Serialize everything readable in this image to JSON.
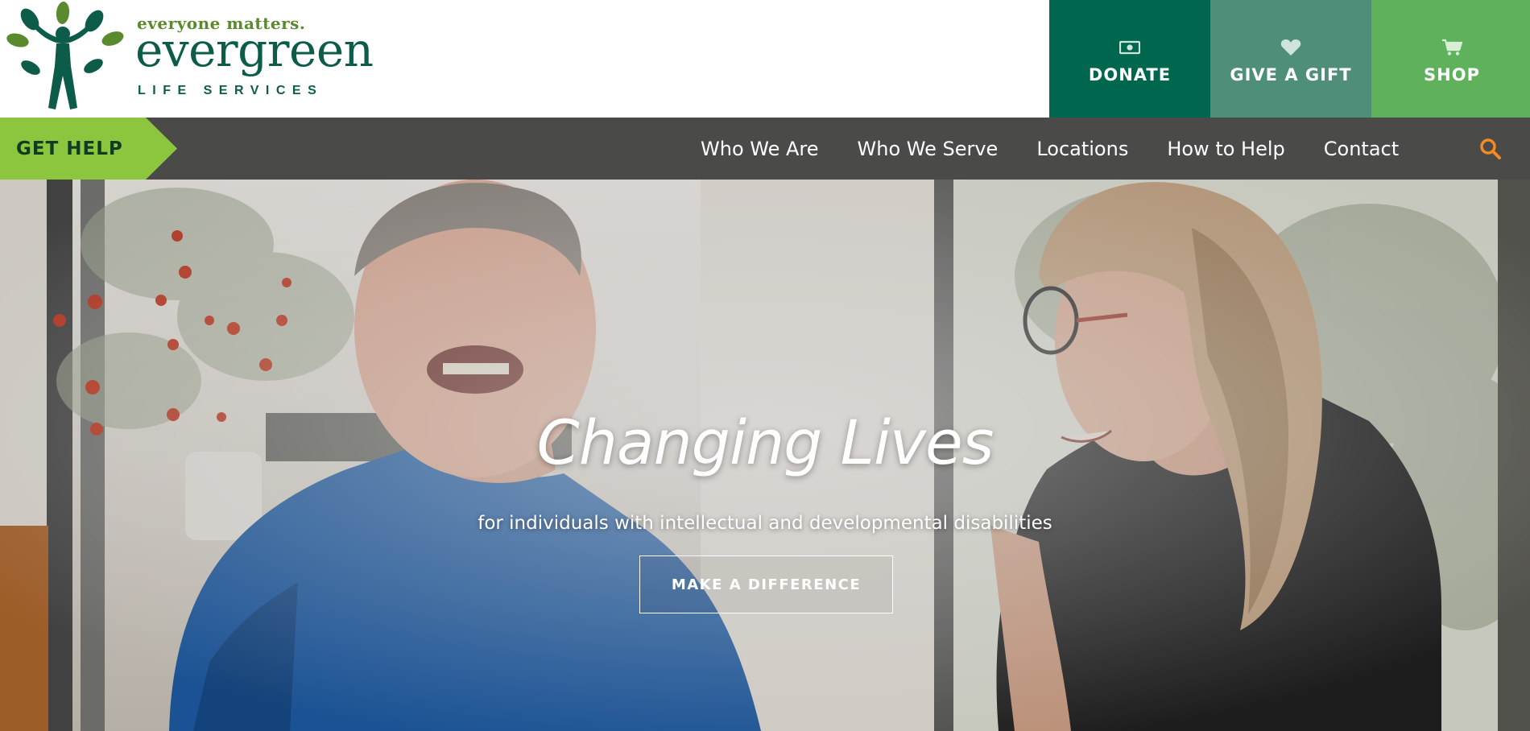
{
  "header": {
    "logo": {
      "tagline": "everyone matters.",
      "name": "evergreen",
      "subtitle": "LIFE SERVICES"
    },
    "top_actions": [
      {
        "label": "DONATE",
        "icon": "money-icon",
        "color": "#00674f"
      },
      {
        "label": "GIVE A GIFT",
        "icon": "heart-icon",
        "color": "#4f8f7a"
      },
      {
        "label": "SHOP",
        "icon": "cart-icon",
        "color": "#5fb15c"
      }
    ]
  },
  "nav": {
    "get_help_label": "GET HELP",
    "get_help_color": "#8cc63f",
    "background": "#4a4a49",
    "links": [
      "Who We Are",
      "Who We Serve",
      "Locations",
      "How to Help",
      "Contact"
    ],
    "search_icon": "search-icon",
    "search_color": "#f58a23"
  },
  "hero": {
    "title": "Changing Lives",
    "subtitle": "for individuals with intellectual and developmental disabilities",
    "cta_label": "MAKE A DIFFERENCE"
  }
}
